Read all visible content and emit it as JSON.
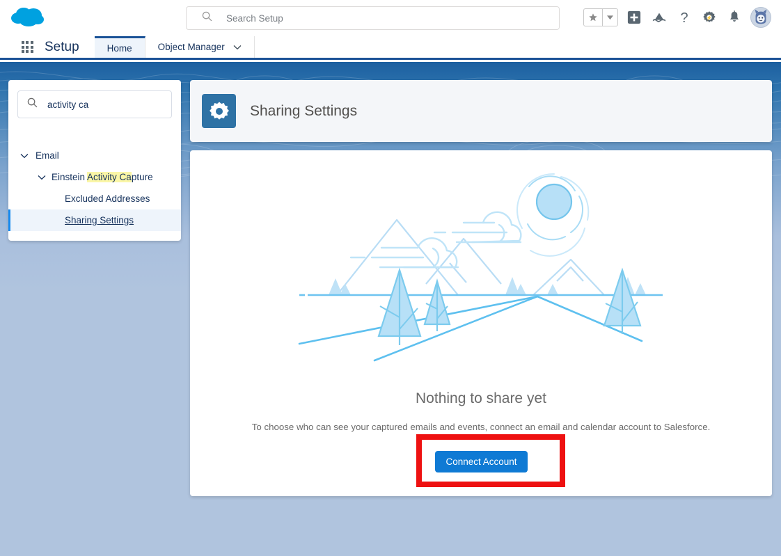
{
  "global_header": {
    "logo_icon": "salesforce-cloud-logo",
    "search": {
      "icon": "search-icon",
      "placeholder": "Search Setup",
      "value": ""
    },
    "icons": [
      {
        "name": "favorites-star-icon",
        "glyph": "★"
      },
      {
        "name": "favorites-dropdown-caret-icon",
        "glyph": "▾"
      },
      {
        "name": "global-actions-plus-icon",
        "glyph": "+"
      },
      {
        "name": "app-launcher-cloud-icon",
        "glyph": "cloud"
      },
      {
        "name": "help-question-icon",
        "glyph": "?"
      },
      {
        "name": "setup-gear-icon",
        "glyph": "gear"
      },
      {
        "name": "notifications-bell-icon",
        "glyph": "bell"
      },
      {
        "name": "user-avatar",
        "glyph": "astro"
      }
    ]
  },
  "setup_nav": {
    "waffle_icon": "app-launcher-waffle-icon",
    "app_name": "Setup",
    "tabs": [
      {
        "label": "Home",
        "active": true,
        "has_caret": false
      },
      {
        "label": "Object Manager",
        "active": false,
        "has_caret": true,
        "caret_icon": "chevron-down-icon"
      }
    ]
  },
  "sidebar": {
    "search": {
      "icon": "search-icon",
      "value": "activity ca",
      "placeholder": "Quick Find"
    },
    "tree": [
      {
        "label": "Email",
        "level": 1,
        "expanded": true,
        "twisty_icon": "chevron-down-icon",
        "selected": false
      },
      {
        "label_prefix": "Einstein ",
        "label_highlight": "Activity Ca",
        "label_suffix": "pture",
        "level": 2,
        "expanded": true,
        "twisty_icon": "chevron-down-icon",
        "selected": false
      },
      {
        "label": "Excluded Addresses",
        "level": 3,
        "expanded": false,
        "selected": false
      },
      {
        "label": "Sharing Settings",
        "level": 3,
        "expanded": false,
        "selected": true
      }
    ]
  },
  "page_header": {
    "icon": "gear-icon",
    "icon_bg": "#2e72a5",
    "title": "Sharing Settings"
  },
  "main": {
    "illustration_name": "empty-state-landscape-illustration",
    "empty_title": "Nothing to share yet",
    "empty_subtitle": "To choose who can see your captured emails and events, connect an email and calendar account to Salesforce.",
    "connect_button_label": "Connect Account",
    "connect_button_color": "#0f7ad4",
    "highlight_box_color": "#ee1111"
  },
  "colors": {
    "brand_blue": "#1b5297",
    "bg_top": "#1b5fa0",
    "bg_bottom": "#b0c4de",
    "illustration_light": "#b7e0f7",
    "illustration_stroke": "#6ec4f0",
    "highlight_yellow": "#faf6a7"
  }
}
